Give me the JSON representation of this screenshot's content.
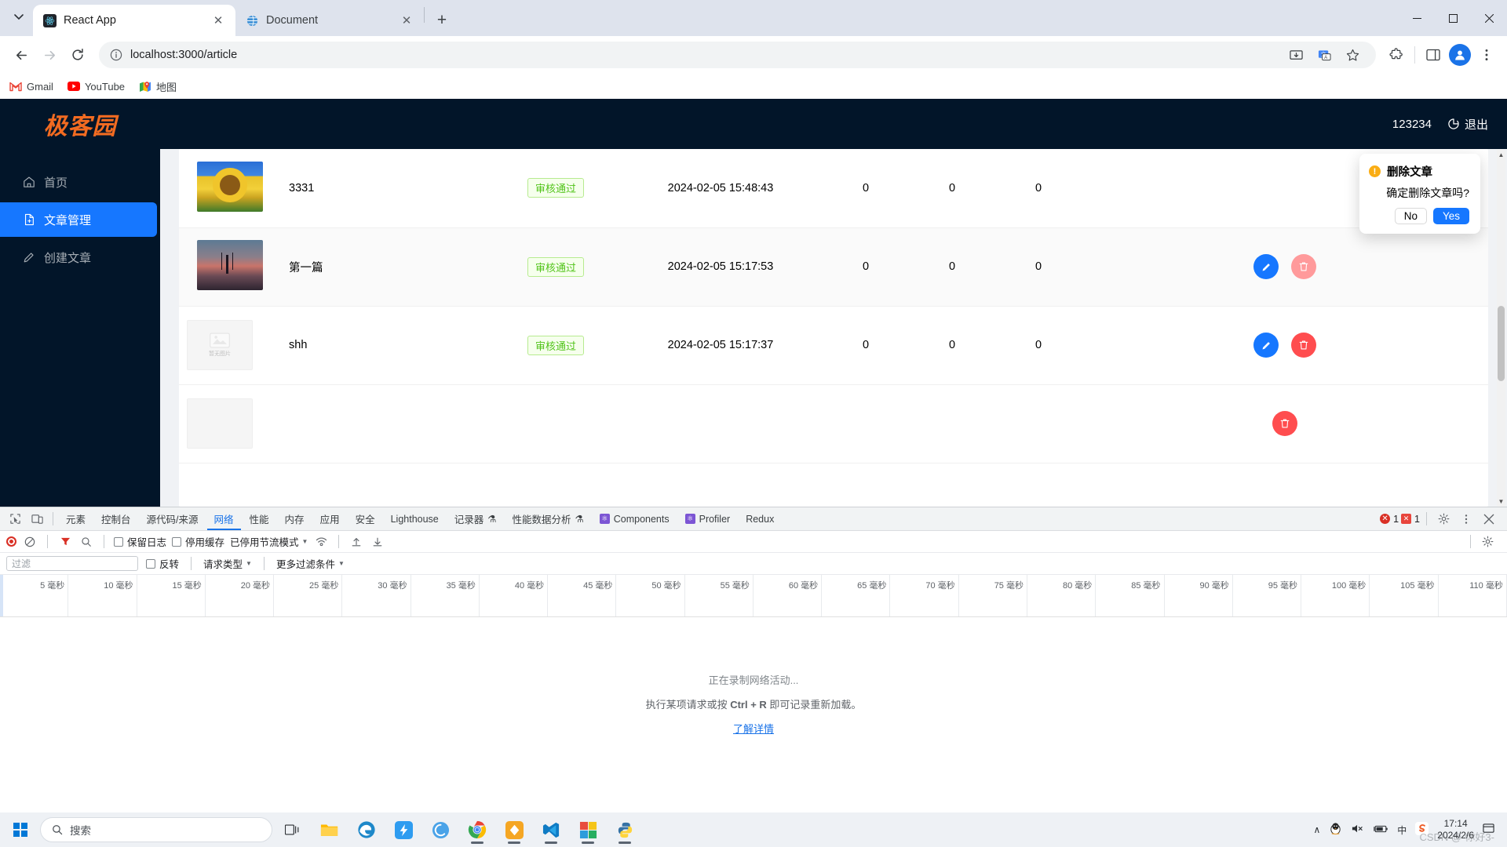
{
  "browser": {
    "tabs": [
      {
        "title": "React App",
        "favicon": "react-icon",
        "active": true
      },
      {
        "title": "Document",
        "favicon": "globe-icon",
        "active": false
      }
    ],
    "new_tab_label": "+",
    "address": "localhost:3000/article",
    "nav": {
      "back": "←",
      "forward": "→",
      "reload": "↻"
    },
    "window_controls": {
      "minimize": "–",
      "maximize": "❐",
      "close": "✕"
    },
    "bookmarks": [
      {
        "label": "Gmail",
        "icon": "gmail-icon"
      },
      {
        "label": "YouTube",
        "icon": "youtube-icon"
      },
      {
        "label": "地图",
        "icon": "maps-icon"
      }
    ]
  },
  "app": {
    "logo": "极客园",
    "username": "123234",
    "logout_label": "退出",
    "sidebar": [
      {
        "label": "首页",
        "icon": "home-icon",
        "active": false
      },
      {
        "label": "文章管理",
        "icon": "document-icon",
        "active": true
      },
      {
        "label": "创建文章",
        "icon": "pencil-icon",
        "active": false
      }
    ],
    "table": {
      "rows": [
        {
          "thumb": "sunflower",
          "title": "3331",
          "status": "审核通过",
          "date": "2024-02-05 15:48:43",
          "reads": "0",
          "comments": "0",
          "likes": "0",
          "alt": false
        },
        {
          "thumb": "palm-sunset",
          "title": "第一篇",
          "status": "审核通过",
          "date": "2024-02-05 15:17:53",
          "reads": "0",
          "comments": "0",
          "likes": "0",
          "alt": true
        },
        {
          "thumb": "no-image",
          "title": "shh",
          "status": "审核通过",
          "date": "2024-02-05 15:17:37",
          "reads": "0",
          "comments": "0",
          "likes": "0",
          "alt": false
        }
      ],
      "no_image_label": "暂无图片",
      "edit_icon": "pencil-icon",
      "delete_icon": "trash-icon"
    },
    "popover": {
      "title": "删除文章",
      "message": "确定删除文章吗?",
      "no_label": "No",
      "yes_label": "Yes",
      "warn_glyph": "!"
    }
  },
  "devtools": {
    "tabs": [
      {
        "label": "元素",
        "active": false
      },
      {
        "label": "控制台",
        "active": false
      },
      {
        "label": "源代码/来源",
        "active": false
      },
      {
        "label": "网络",
        "active": true
      },
      {
        "label": "性能",
        "active": false
      },
      {
        "label": "内存",
        "active": false
      },
      {
        "label": "应用",
        "active": false
      },
      {
        "label": "安全",
        "active": false
      },
      {
        "label": "Lighthouse",
        "active": false
      },
      {
        "label": "记录器",
        "active": false,
        "suffix": "⚗"
      },
      {
        "label": "性能数据分析",
        "active": false,
        "suffix": "⚗"
      }
    ],
    "ext_tabs": [
      {
        "label": "Components",
        "icon": "react-icon"
      },
      {
        "label": "Profiler",
        "icon": "react-icon"
      },
      {
        "label": "Redux",
        "icon": ""
      }
    ],
    "error_count": "1",
    "warning_count": "1",
    "toolbar": {
      "record_title": "record",
      "clear_title": "clear",
      "preserve_log": "保留日志",
      "disable_cache": "停用缓存",
      "throttle": "已停用节流模式"
    },
    "filterbar": {
      "filter_placeholder": "过滤",
      "invert": "反转",
      "request_type": "请求类型",
      "more_filters": "更多过滤条件"
    },
    "ruler_ticks": [
      "5 毫秒",
      "10 毫秒",
      "15 毫秒",
      "20 毫秒",
      "25 毫秒",
      "30 毫秒",
      "35 毫秒",
      "40 毫秒",
      "45 毫秒",
      "50 毫秒",
      "55 毫秒",
      "60 毫秒",
      "65 毫秒",
      "70 毫秒",
      "75 毫秒",
      "80 毫秒",
      "85 毫秒",
      "90 毫秒",
      "95 毫秒",
      "100 毫秒",
      "105 毫秒",
      "110 毫秒"
    ],
    "empty_state": {
      "line1": "正在录制网络活动...",
      "line2_a": "执行某项请求或按 ",
      "line2_key": "Ctrl + R",
      "line2_b": " 即可记录重新加载。",
      "link": "了解详情"
    }
  },
  "taskbar": {
    "search_placeholder": "搜索",
    "apps": [
      {
        "name": "task-view-icon"
      },
      {
        "name": "file-explorer-icon"
      },
      {
        "name": "edge-icon"
      },
      {
        "name": "thunder-icon"
      },
      {
        "name": "app-blue-icon"
      },
      {
        "name": "chrome-icon"
      },
      {
        "name": "diamond-icon"
      },
      {
        "name": "vscode-icon"
      },
      {
        "name": "grid-app-icon"
      },
      {
        "name": "python-icon"
      }
    ],
    "tray": {
      "chevron": "∧",
      "qq": "qq-icon",
      "volume": "volume-muted-icon",
      "battery": "battery-icon",
      "ime": "中",
      "sogou": "S"
    },
    "time": "17:14",
    "date": "2024/2/6",
    "watermark": "CSDN @-你好3-"
  },
  "colors": {
    "accent": "#1677ff",
    "brand": "#f26b21",
    "header_bg": "#021529",
    "success": "#52c41a",
    "danger": "#ff4d4f"
  }
}
